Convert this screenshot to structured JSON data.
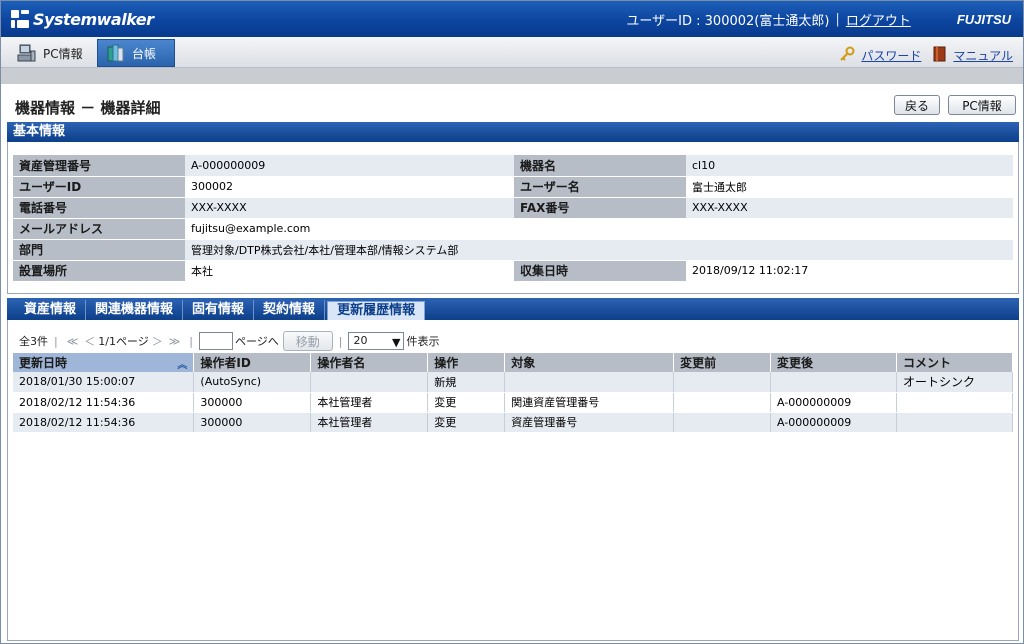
{
  "header": {
    "logo": "Systemwalker",
    "user_label": "ユーザーID : 300002(富士通太郎)",
    "logout": "ログアウト",
    "brand": "FUJITSU"
  },
  "tabs": [
    {
      "label": "PC情報",
      "icon": "pc-icon"
    },
    {
      "label": "台帳",
      "icon": "ledger-icon"
    }
  ],
  "toplinks": {
    "password": "パスワード",
    "manual": "マニュアル"
  },
  "page": {
    "title": "機器情報 － 機器詳細",
    "back_button": "戻る",
    "pc_info_button": "PC情報"
  },
  "basic": {
    "header": "基本情報",
    "rows": [
      {
        "l1": "資産管理番号",
        "v1": "A-000000009",
        "l2": "機器名",
        "v2": "cl10"
      },
      {
        "l1": "ユーザーID",
        "v1": "300002",
        "l2": "ユーザー名",
        "v2": "富士通太郎"
      },
      {
        "l1": "電話番号",
        "v1": "XXX-XXXX",
        "l2": "FAX番号",
        "v2": "XXX-XXXX"
      },
      {
        "l1": "メールアドレス",
        "v1": "fujitsu@example.com"
      },
      {
        "l1": "部門",
        "v1": "管理対象/DTP株式会社/本社/管理本部/情報システム部"
      },
      {
        "l1": "設置場所",
        "v1": "本社",
        "l2": "収集日時",
        "v2": "2018/09/12 11:02:17"
      }
    ]
  },
  "subtabs": [
    "資産情報",
    "関連機器情報",
    "固有情報",
    "契約情報",
    "更新履歴情報"
  ],
  "pager": {
    "total": "全3件",
    "first": "≪",
    "prev": "＜",
    "page": "1/1ページ",
    "next": "＞",
    "last": "≫",
    "goto_suffix": "ページへ",
    "move": "移動",
    "per_page": "20",
    "per_page_suffix": "件表示"
  },
  "history": {
    "columns": [
      "更新日時",
      "操作者ID",
      "操作者名",
      "操作",
      "対象",
      "変更前",
      "変更後",
      "コメント"
    ],
    "rows": [
      [
        "2018/01/30 15:00:07",
        "(AutoSync)",
        "",
        "新規",
        "",
        "",
        "",
        "オートシンク"
      ],
      [
        "2018/02/12 11:54:36",
        "300000",
        "本社管理者",
        "変更",
        "関連資産管理番号",
        "",
        "A-000000009",
        ""
      ],
      [
        "2018/02/12 11:54:36",
        "300000",
        "本社管理者",
        "変更",
        "資産管理番号",
        "",
        "A-000000009",
        ""
      ]
    ]
  }
}
